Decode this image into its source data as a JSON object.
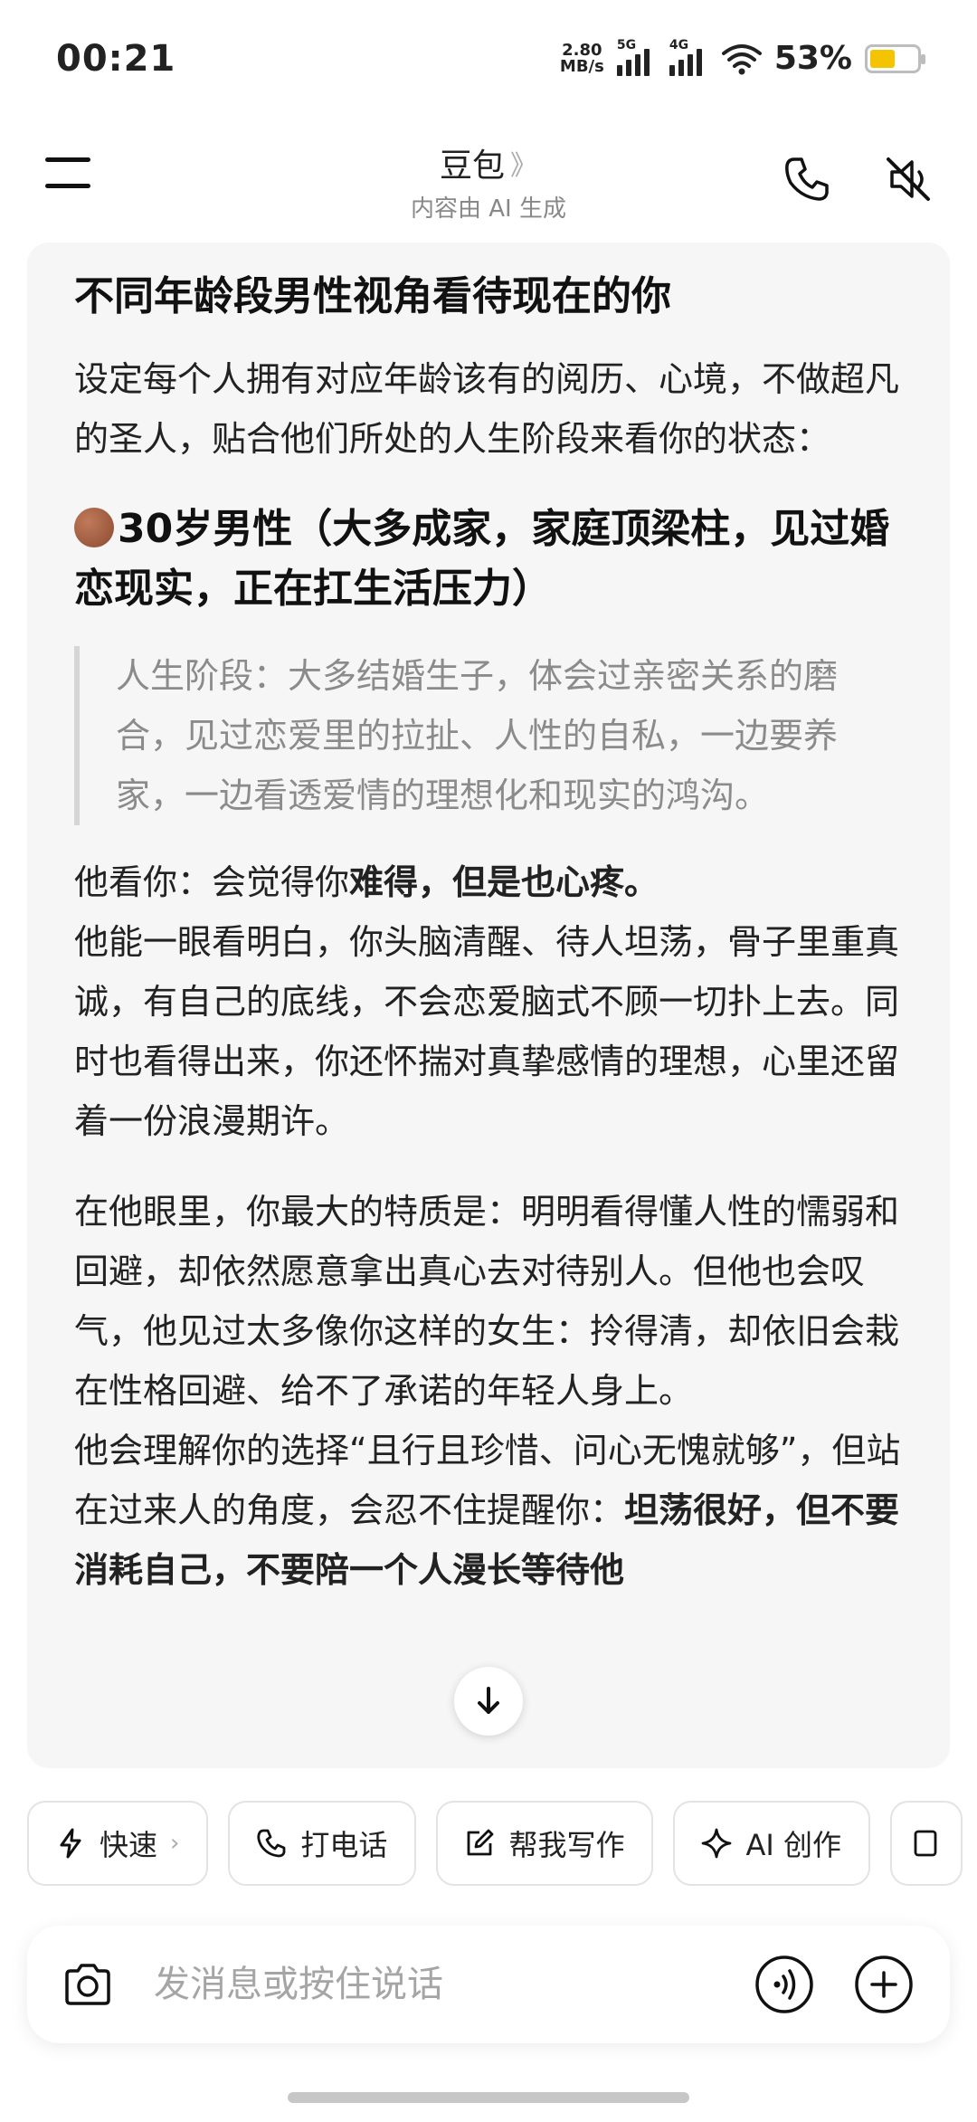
{
  "status": {
    "time": "00:21",
    "netspeed_value": "2.80",
    "netspeed_unit": "MB/s",
    "sig1_tag": "5G",
    "sig2_tag": "4G",
    "battery_percent": "53%",
    "battery_level": 0.53,
    "battery_color": "#f5c400"
  },
  "header": {
    "title": "豆包",
    "title_chevron": "》",
    "subtitle": "内容由 AI 生成",
    "icons": [
      "menu-icon",
      "phone-icon",
      "speaker-mute-icon"
    ]
  },
  "message": {
    "heading": "不同年龄段男性视角看待现在的你",
    "intro": "设定每个人拥有对应年龄该有的阅历、心境，不做超凡的圣人，贴合他们所处的人生阶段来看你的状态：",
    "section_title": "30岁男性（大多成家，家庭顶梁柱，见过婚恋现实，正在扛生活压力）",
    "quote": "人生阶段：大多结婚生子，体会过亲密关系的磨合，见过恋爱里的拉扯、人性的自私，一边要养家，一边看透爱情的理想化和现实的鸿沟。",
    "para1_lead": "他看你：会觉得你",
    "para1_bold": "难得，但是也心疼。",
    "para1_rest": "他能一眼看明白，你头脑清醒、待人坦荡，骨子里重真诚，有自己的底线，不会恋爱脑式不顾一切扑上去。同时也看得出来，你还怀揣对真挚感情的理想，心里还留着一份浪漫期许。",
    "para2": "在他眼里，你最大的特质是：明明看得懂人性的懦弱和回避，却依然愿意拿出真心去对待别人。但他也会叹气，他见过太多像你这样的女生：拎得清，却依旧会栽在性格回避、给不了承诺的年轻人身上。",
    "para3_lead": "他会理解你的选择“且行且珍惜、问心无愧就够”，但站在过来人的角度，会忍不住提醒你：",
    "para3_bold": "坦荡很好，但不要消耗自己，不要陪一个人漫长等待他"
  },
  "chips": [
    {
      "label": "快速",
      "icon": "lightning-icon",
      "chevron": "›"
    },
    {
      "label": "打电话",
      "icon": "phone-icon"
    },
    {
      "label": "帮我写作",
      "icon": "edit-icon"
    },
    {
      "label": "AI 创作",
      "icon": "sparkle-icon"
    }
  ],
  "input": {
    "placeholder": "发消息或按住说话"
  }
}
